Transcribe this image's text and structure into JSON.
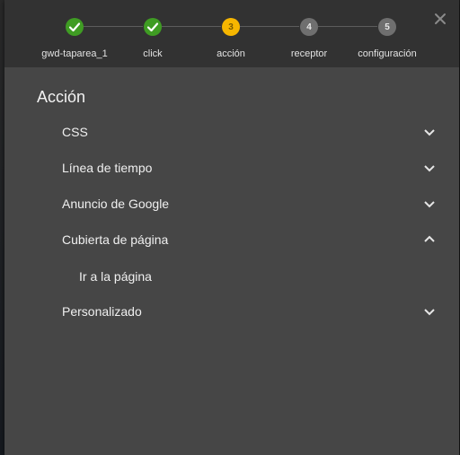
{
  "steps": [
    {
      "label": "gwd-taparea_1",
      "state": "done",
      "number": "1"
    },
    {
      "label": "click",
      "state": "done",
      "number": "2"
    },
    {
      "label": "acción",
      "state": "active",
      "number": "3"
    },
    {
      "label": "receptor",
      "state": "pending",
      "number": "4"
    },
    {
      "label": "configuración",
      "state": "pending",
      "number": "5"
    }
  ],
  "colors": {
    "done": "#3f9c23",
    "active": "#f6b600",
    "pending": "#6f6f6f",
    "dialog_bg": "#464646",
    "stepper_bg": "#323232"
  },
  "close_icon": "close-icon",
  "section_title": "Acción",
  "actions": [
    {
      "label": "CSS",
      "expanded": false,
      "icon": "chevron-down-icon"
    },
    {
      "label": "Línea de tiempo",
      "expanded": false,
      "icon": "chevron-down-icon"
    },
    {
      "label": "Anuncio de Google",
      "expanded": false,
      "icon": "chevron-down-icon"
    },
    {
      "label": "Cubierta de página",
      "expanded": true,
      "icon": "chevron-up-icon",
      "children": [
        {
          "label": "Ir a la página"
        }
      ]
    },
    {
      "label": "Personalizado",
      "expanded": false,
      "icon": "chevron-down-icon"
    }
  ]
}
